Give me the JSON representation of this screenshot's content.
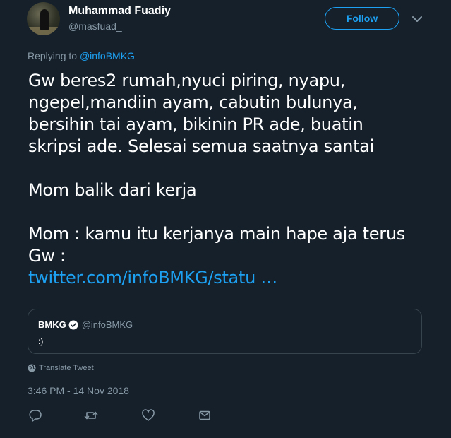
{
  "user": {
    "display_name": "Muhammad Fuadiy",
    "handle": "@masfuad_",
    "follow_label": "Follow"
  },
  "reply": {
    "prefix": "Replying to",
    "to": "@infoBMKG"
  },
  "tweet": {
    "lines": [
      "Gw beres2 rumah,nyuci piring, nyapu,",
      "ngepel,mandiin ayam, cabutin bulunya,",
      "bersihin tai ayam, bikinin PR ade, buatin",
      "skripsi ade. Selesai semua saatnya santai",
      "",
      "Mom balik dari kerja",
      "",
      "Mom : kamu itu kerjanya main hape aja terus",
      "Gw :"
    ],
    "link": "twitter.com/infoBMKG/statu …"
  },
  "quote": {
    "name": "BMKG",
    "handle": "@infoBMKG",
    "text": ":)"
  },
  "translate_label": "Translate Tweet",
  "timestamp": "3:46 PM - 14 Nov 2018",
  "colors": {
    "background": "#15202b",
    "accent": "#1da1f2",
    "muted": "#8899a6",
    "border": "#38444d"
  },
  "icons": {
    "reply": "reply-icon",
    "retweet": "retweet-icon",
    "like": "heart-icon",
    "dm": "envelope-icon",
    "caret": "chevron-down-icon",
    "verified": "verified-badge-icon",
    "translate": "globe-icon"
  }
}
